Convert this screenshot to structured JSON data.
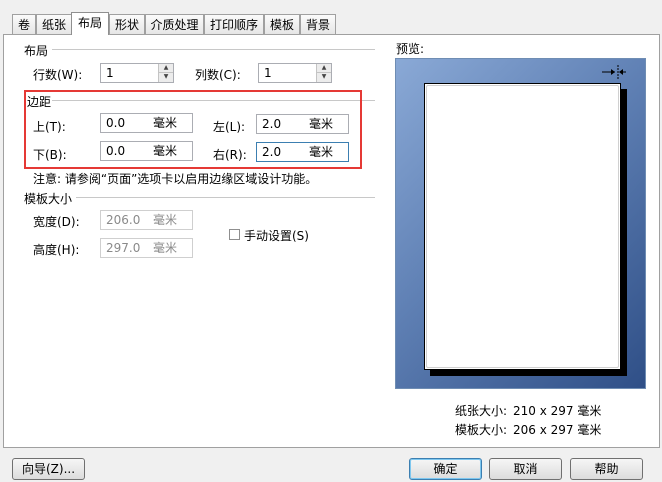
{
  "tabs": [
    "卷",
    "纸张",
    "布局",
    "形状",
    "介质处理",
    "打印顺序",
    "模板",
    "背景"
  ],
  "active_tab": "布局",
  "layout_group": {
    "title": "布局",
    "rows_label": "行数(W):",
    "rows_value": "1",
    "cols_label": "列数(C):",
    "cols_value": "1"
  },
  "margins_group": {
    "title": "边距",
    "top_label": "上(T):",
    "top_value": "0.0",
    "bottom_label": "下(B):",
    "bottom_value": "0.0",
    "left_label": "左(L):",
    "left_value": "2.0",
    "right_label": "右(R):",
    "right_value": "2.0",
    "unit": "毫米",
    "note": "注意: 请参阅“页面”选项卡以启用边缘区域设计功能。"
  },
  "template_size_group": {
    "title": "模板大小",
    "width_label": "宽度(D):",
    "width_value": "206.0",
    "height_label": "高度(H):",
    "height_value": "297.0",
    "unit": "毫米",
    "manual_label": "手动设置(S)",
    "manual_checked": false
  },
  "preview": {
    "title": "预览:",
    "paper_size_label": "纸张大小:",
    "paper_size_value": "210 x 297 毫米",
    "template_size_label": "模板大小:",
    "template_size_value": "206 x 297 毫米"
  },
  "buttons": {
    "wizard": "向导(Z)...",
    "ok": "确定",
    "cancel": "取消",
    "help": "帮助"
  }
}
